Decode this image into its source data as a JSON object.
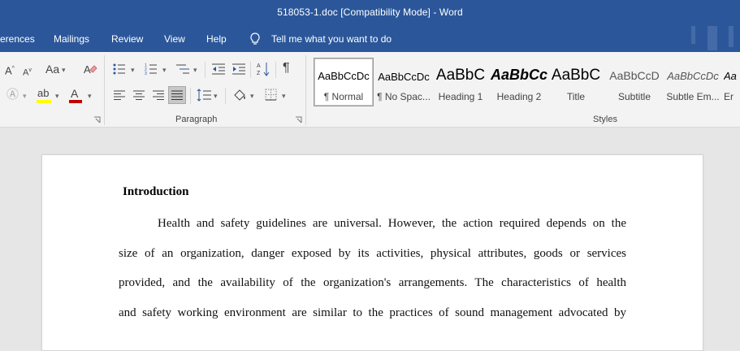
{
  "window": {
    "title": "518053-1.doc [Compatibility Mode]  -  Word"
  },
  "menu": {
    "tabs": [
      "erences",
      "Mailings",
      "Review",
      "View",
      "Help"
    ],
    "tell_me": "Tell me what you want to do"
  },
  "ribbon": {
    "paragraph_label": "Paragraph",
    "styles_label": "Styles",
    "font_size_label": "Aa",
    "colors": {
      "highlight": "#ffff00",
      "font_color": "#c00000"
    },
    "styles": [
      {
        "sample": "AaBbCcDc",
        "name": "¶ Normal"
      },
      {
        "sample": "AaBbCcDc",
        "name": "¶ No Spac..."
      },
      {
        "sample": "AaBbC",
        "name": "Heading 1"
      },
      {
        "sample": "AaBbCc",
        "name": "Heading 2"
      },
      {
        "sample": "AaBbC",
        "name": "Title"
      },
      {
        "sample": "AaBbCcD",
        "name": "Subtitle"
      },
      {
        "sample": "AaBbCcDc",
        "name": "Subtle Em..."
      },
      {
        "sample": "Aa",
        "name": "Er"
      }
    ]
  },
  "document": {
    "heading": "Introduction",
    "lines": [
      "Health and safety guidelines are universal. However, the action required depends on the",
      "size of an organization, danger exposed by its activities, physical attributes, goods or services",
      "provided, and the availability of the organization's arrangements. The characteristics of health",
      "and safety working environment are similar to the practices of sound management advocated by"
    ]
  }
}
